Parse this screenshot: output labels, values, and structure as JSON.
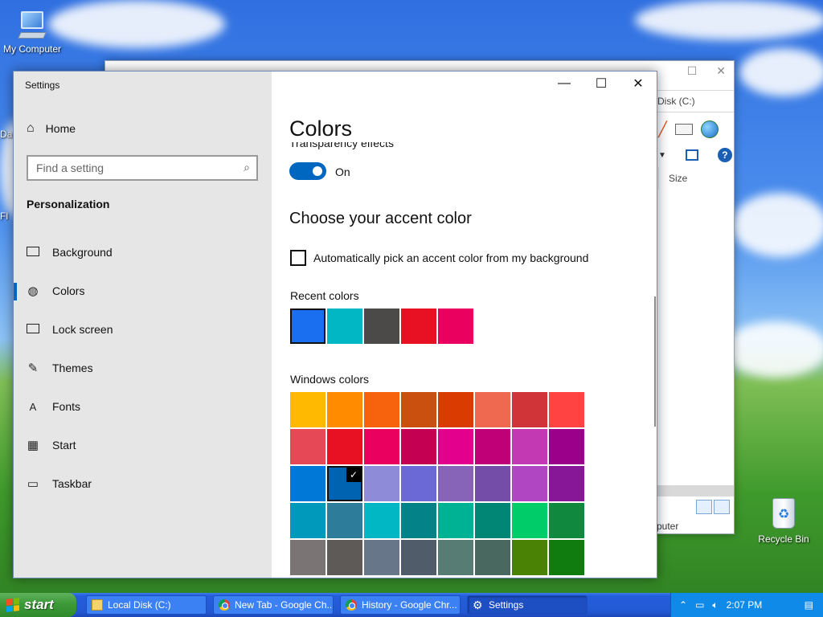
{
  "desktop": {
    "icons": [
      {
        "label": "My Computer"
      },
      {
        "label": "Recycle Bin"
      }
    ],
    "partial_labels": [
      "Da",
      "Fl"
    ]
  },
  "explorer": {
    "address": "Disk (C:)",
    "column": "Size",
    "status": "puter",
    "controls": {
      "maximize": "☐",
      "close": "✕"
    }
  },
  "settings": {
    "title": "Settings",
    "controls": {
      "minimize": "—",
      "maximize": "☐",
      "close": "✕"
    },
    "home_label": "Home",
    "search_placeholder": "Find a setting",
    "section": "Personalization",
    "nav": [
      {
        "label": "Background",
        "icon": "picture-icon"
      },
      {
        "label": "Colors",
        "icon": "palette-icon",
        "active": true
      },
      {
        "label": "Lock screen",
        "icon": "lock-screen-icon"
      },
      {
        "label": "Themes",
        "icon": "themes-icon"
      },
      {
        "label": "Fonts",
        "icon": "fonts-icon"
      },
      {
        "label": "Start",
        "icon": "start-icon"
      },
      {
        "label": "Taskbar",
        "icon": "taskbar-icon"
      }
    ],
    "page_title": "Colors",
    "transparency_label": "Transparency effects",
    "toggle_state": "On",
    "accent_heading": "Choose your accent color",
    "auto_pick_label": "Automatically pick an accent color from my background",
    "recent_label": "Recent colors",
    "recent_colors": [
      "#1a6ef0",
      "#00b7c3",
      "#4c4a48",
      "#e81123",
      "#ea005e"
    ],
    "windows_label": "Windows colors",
    "windows_colors": [
      "#ffb900",
      "#ff8c00",
      "#f7630c",
      "#ca5010",
      "#da3b01",
      "#ef6950",
      "#d13438",
      "#ff4343",
      "#e74856",
      "#e81123",
      "#ea005e",
      "#c30052",
      "#e3008c",
      "#bf0077",
      "#c239b3",
      "#9a0089",
      "#0078d7",
      "#0063b1",
      "#8e8cd8",
      "#6b69d6",
      "#8764b8",
      "#744da9",
      "#b146c2",
      "#881798",
      "#0099bc",
      "#2d7d9a",
      "#00b7c3",
      "#038387",
      "#00b294",
      "#018574",
      "#00cc6a",
      "#10893e",
      "#7a7574",
      "#5d5a58",
      "#68768a",
      "#515c6b",
      "#567c73",
      "#486860",
      "#498205",
      "#107c10"
    ],
    "selected_index": 17
  },
  "taskbar": {
    "start_label": "start",
    "tasks": [
      {
        "label": "Local Disk (C:)",
        "icon": "folder-icon"
      },
      {
        "label": "New Tab - Google Ch...",
        "icon": "chrome-icon"
      },
      {
        "label": "History - Google Chr...",
        "icon": "chrome-icon"
      },
      {
        "label": "Settings",
        "icon": "gear-icon",
        "active": true
      }
    ],
    "clock": "2:07 PM"
  }
}
